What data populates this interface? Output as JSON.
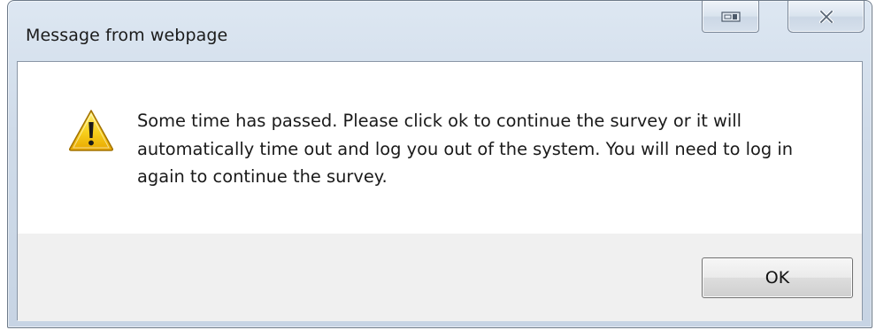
{
  "window": {
    "title": "Message from webpage"
  },
  "title_buttons": [
    {
      "icon": "compatibility-view-icon"
    },
    {
      "icon": "close-icon"
    }
  ],
  "dialog": {
    "icon": "warning-icon",
    "message": "Some time has passed. Please click ok to continue the survey or it will automatically time out and log you out of the system. You will need to log in again to continue the survey.",
    "ok_label": "OK"
  },
  "colors": {
    "frame": "#cfdbe9",
    "footer": "#f0f0f0",
    "warning_yellow": "#f5c400"
  }
}
